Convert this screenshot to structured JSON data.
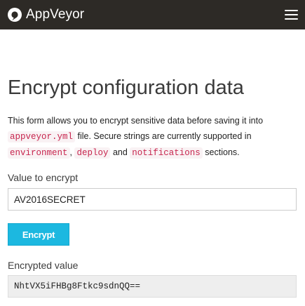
{
  "navbar": {
    "brand_name": "AppVeyor",
    "brand_color": "#2d2a26",
    "logo_icon": "appveyor-logo-icon",
    "menu_icon": "hamburger-menu-icon"
  },
  "page": {
    "title": "Encrypt configuration data",
    "description": {
      "part1": "This form allows you to encrypt sensitive data before saving it into ",
      "code1": "appveyor.yml",
      "part2": " file. Secure strings are currently supported in ",
      "code2": "environment",
      "part3": ", ",
      "code3": "deploy",
      "part4": " and ",
      "code4": "notifications",
      "part5": " sections."
    }
  },
  "form": {
    "value_label": "Value to encrypt",
    "value_input": "AV2016SECRET",
    "encrypt_button": "Encrypt",
    "button_color": "#1cb8e0",
    "encrypted_label": "Encrypted value",
    "encrypted_output": "NhtVX5iFHBg8Ftkc9sdnQQ=="
  }
}
